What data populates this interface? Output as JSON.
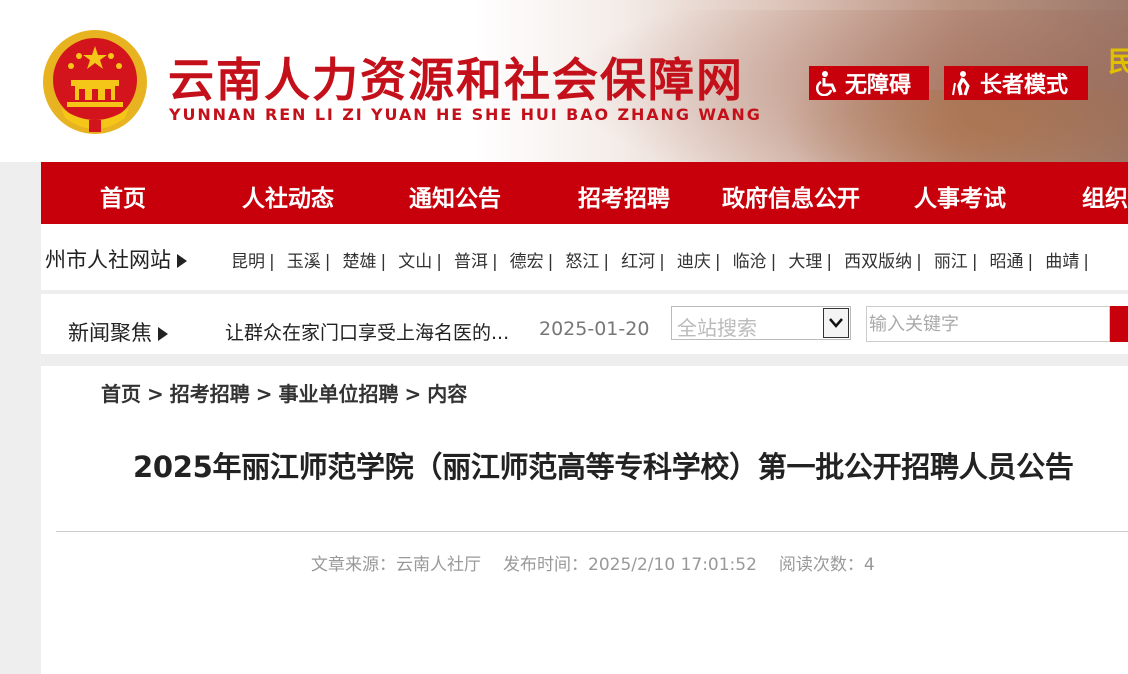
{
  "header": {
    "site_title": "云南人力资源和社会保障网",
    "site_pinyin": "YUNNAN REN LI ZI YUAN HE SHE HUI BAO ZHANG WANG",
    "accessibility_button": "无障碍",
    "elder_mode_button": "长者模式",
    "cut_off_text": "民",
    "accent_color": "#c8000b"
  },
  "nav": {
    "items": [
      "首页",
      "人社动态",
      "通知公告",
      "招考招聘",
      "政府信息公开",
      "人事考试",
      "组织"
    ]
  },
  "city_bar": {
    "label": "州市人社网站",
    "cities": [
      "昆明",
      "玉溪",
      "楚雄",
      "文山",
      "普洱",
      "德宏",
      "怒江",
      "红河",
      "迪庆",
      "临沧",
      "大理",
      "西双版纳",
      "丽江",
      "昭通",
      "曲靖"
    ],
    "separator": "|"
  },
  "news_bar": {
    "label": "新闻聚焦",
    "headline": "让群众在家门口享受上海名医的...",
    "date": "2025-01-20",
    "search_scope": "全站搜索",
    "search_placeholder": "输入关键字"
  },
  "breadcrumb": {
    "items": [
      "首页",
      "招考招聘",
      "事业单位招聘",
      "内容"
    ],
    "separator": ">"
  },
  "article": {
    "title": "2025年丽江师范学院（丽江师范高等专科学校）第一批公开招聘人员公告",
    "source": "文章来源：云南人社厅",
    "published": "发布时间：2025/2/10 17:01:52",
    "reads": "阅读次数：4"
  }
}
